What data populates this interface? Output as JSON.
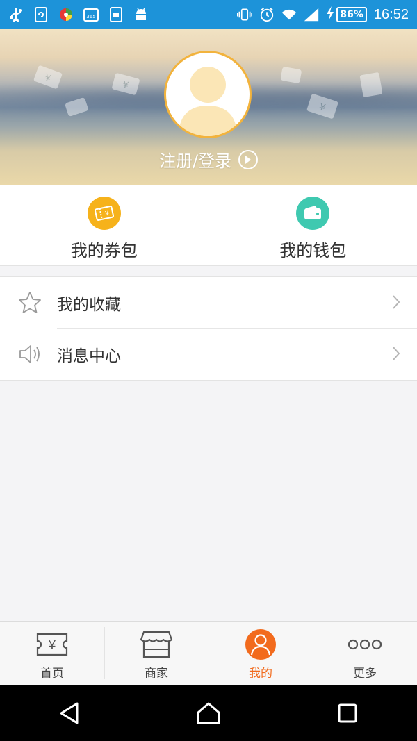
{
  "status_bar": {
    "battery": "86%",
    "time": "16:52",
    "left_icons": [
      "usb-icon",
      "sync-icon",
      "app-icon",
      "calendar-365-icon",
      "sim-icon",
      "android-icon"
    ],
    "right_icons": [
      "vibrate-icon",
      "alarm-icon",
      "wifi-icon",
      "signal-icon",
      "charging-icon"
    ],
    "calendar_text": "365"
  },
  "header": {
    "login_label": "注册/登录"
  },
  "wallet": [
    {
      "label": "我的券包",
      "icon": "ticket-icon",
      "color": "#f6b21b"
    },
    {
      "label": "我的钱包",
      "icon": "wallet-icon",
      "color": "#3fc9b0"
    }
  ],
  "menu": [
    {
      "label": "我的收藏",
      "icon": "star-icon"
    },
    {
      "label": "消息中心",
      "icon": "speaker-icon"
    }
  ],
  "tabs": [
    {
      "label": "首页",
      "icon": "coupon-yen-icon",
      "active": false
    },
    {
      "label": "商家",
      "icon": "store-icon",
      "active": false
    },
    {
      "label": "我的",
      "icon": "person-icon",
      "active": true
    },
    {
      "label": "更多",
      "icon": "more-icon",
      "active": false
    }
  ],
  "theme": {
    "accent": "#f26b1d",
    "status_bar": "#1d93d9",
    "coupon": "#f6b21b",
    "wallet": "#3fc9b0"
  }
}
